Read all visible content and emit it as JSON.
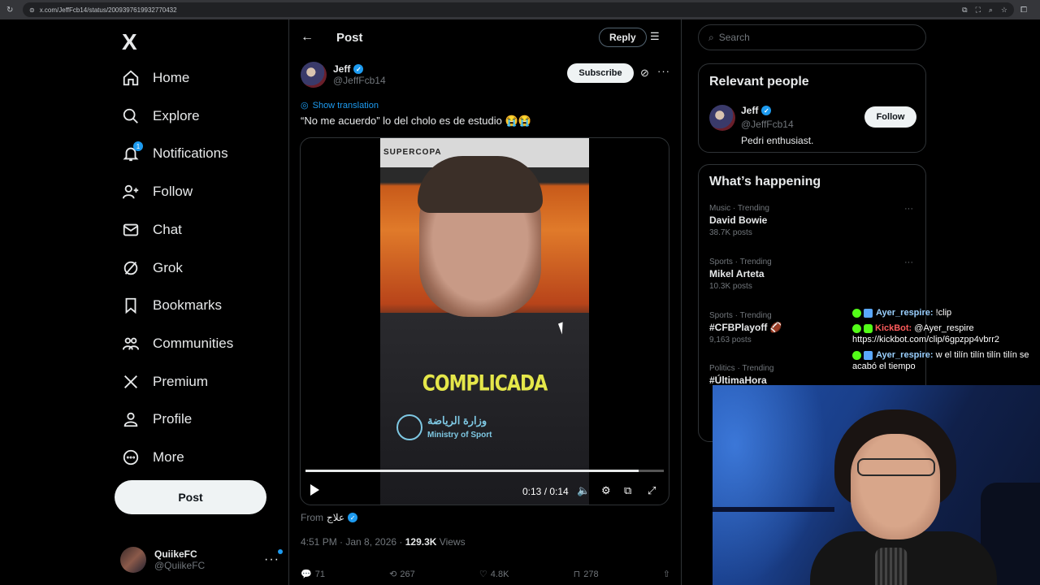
{
  "browser": {
    "url": "x.com/JeffFcb14/status/2009397619932770432"
  },
  "nav": {
    "logo": "X",
    "items": [
      {
        "label": "Home",
        "icon": "home-icon"
      },
      {
        "label": "Explore",
        "icon": "search-icon"
      },
      {
        "label": "Notifications",
        "icon": "bell-icon",
        "badge": "1"
      },
      {
        "label": "Follow",
        "icon": "person-add-icon"
      },
      {
        "label": "Chat",
        "icon": "mail-icon"
      },
      {
        "label": "Grok",
        "icon": "grok-icon"
      },
      {
        "label": "Bookmarks",
        "icon": "bookmark-icon"
      },
      {
        "label": "Communities",
        "icon": "communities-icon"
      },
      {
        "label": "Premium",
        "icon": "x-premium-icon"
      },
      {
        "label": "Profile",
        "icon": "person-icon"
      },
      {
        "label": "More",
        "icon": "more-circle-icon"
      }
    ],
    "post_label": "Post",
    "me": {
      "name": "QuiikeFC",
      "handle": "@QuiikeFC"
    }
  },
  "post": {
    "header_title": "Post",
    "reply_label": "Reply",
    "author_name": "Jeff",
    "author_handle": "@JeffFcb14",
    "subscribe_label": "Subscribe",
    "show_translation": "Show translation",
    "text": "“No me acuerdo” lo del cholo es de estudio 😭😭",
    "video": {
      "sponsor": "SUPERCOPA",
      "caption": "COMPLICADA",
      "ministry_ar": "وزارة الرياضة",
      "ministry_en": "Ministry of Sport",
      "time": "0:13 / 0:14",
      "progress": 0.93
    },
    "from_label": "From",
    "from_source": "علاج",
    "time": "4:51 PM · Jan 8, 2026 ·",
    "views_count": "129.3K",
    "views_label": "Views",
    "actions": {
      "replies": "71",
      "reposts": "267",
      "likes": "4.8K",
      "bookmarks": "278"
    }
  },
  "sidebar": {
    "search_placeholder": "Search",
    "relevant_title": "Relevant people",
    "relevant": {
      "name": "Jeff",
      "handle": "@JeffFcb14",
      "bio": "Pedri enthusiast.",
      "follow_label": "Follow"
    },
    "happening_title": "What’s happening",
    "trends": [
      {
        "category": "Music · Trending",
        "name": "David Bowie",
        "posts": "38.7K posts"
      },
      {
        "category": "Sports · Trending",
        "name": "Mikel Arteta",
        "posts": "10.3K posts"
      },
      {
        "category": "Sports · Trending",
        "name": "#CFBPlayoff 🏈",
        "posts": "9,163 posts"
      },
      {
        "category": "Politics · Trending",
        "name": "#ÚltimaHora",
        "posts": ""
      }
    ]
  },
  "chat": [
    {
      "user": "Ayer_respire:",
      "message": "!clip"
    },
    {
      "user": "KickBot:",
      "message": "@Ayer_respire https://kickbot.com/clip/6gpzpp4vbrr2"
    },
    {
      "user": "Ayer_respire:",
      "message": "w el tilín tilín tilín tilín se acabó el tiempo"
    }
  ],
  "colors": {
    "accent": "#1d9bf0",
    "background": "#000000",
    "border": "#2f3336",
    "caption": "#e5e74a"
  }
}
